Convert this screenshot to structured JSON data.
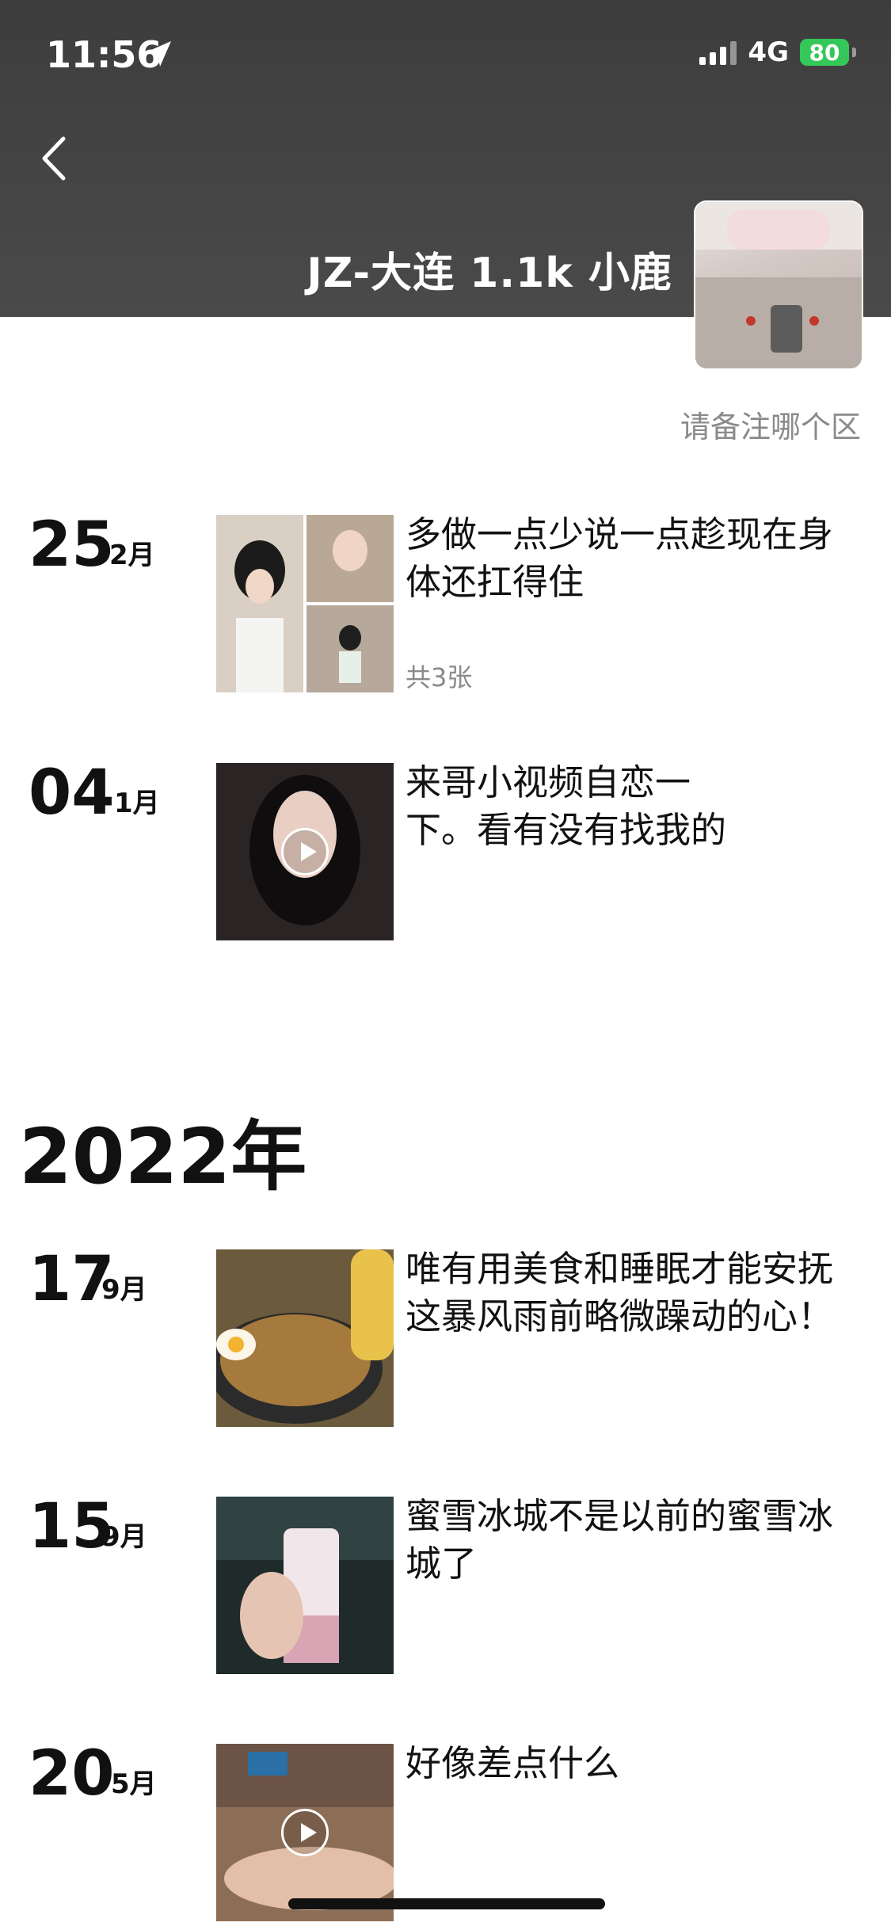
{
  "status_bar": {
    "time": "11:56",
    "network": "4G",
    "battery": "80",
    "icons": [
      "location-arrow-icon",
      "signal-icon",
      "battery-icon"
    ]
  },
  "header": {
    "profile_name": "JZ-大连   1.1k  小鹿",
    "back_icon": "chevron-left-icon"
  },
  "signature": "请备注哪个区",
  "posts_2023": [
    {
      "day": "25",
      "month": "2月",
      "text": "多做一点少说一点趁现在身体还扛得住",
      "count": "共3张",
      "type": "photos"
    },
    {
      "day": "04",
      "month": "1月",
      "text": "来哥小视频自恋一下。看有没有找我的",
      "type": "video"
    }
  ],
  "year_2022": "2022年",
  "posts_2022": [
    {
      "day": "17",
      "month": "9月",
      "text": "唯有用美食和睡眠才能安抚这暴风雨前略微躁动的心！",
      "type": "photo"
    },
    {
      "day": "15",
      "month": "9月",
      "text": "蜜雪冰城不是以前的蜜雪冰城了",
      "type": "photo"
    },
    {
      "day": "20",
      "month": "5月",
      "text": "好像差点什么",
      "type": "video"
    }
  ]
}
